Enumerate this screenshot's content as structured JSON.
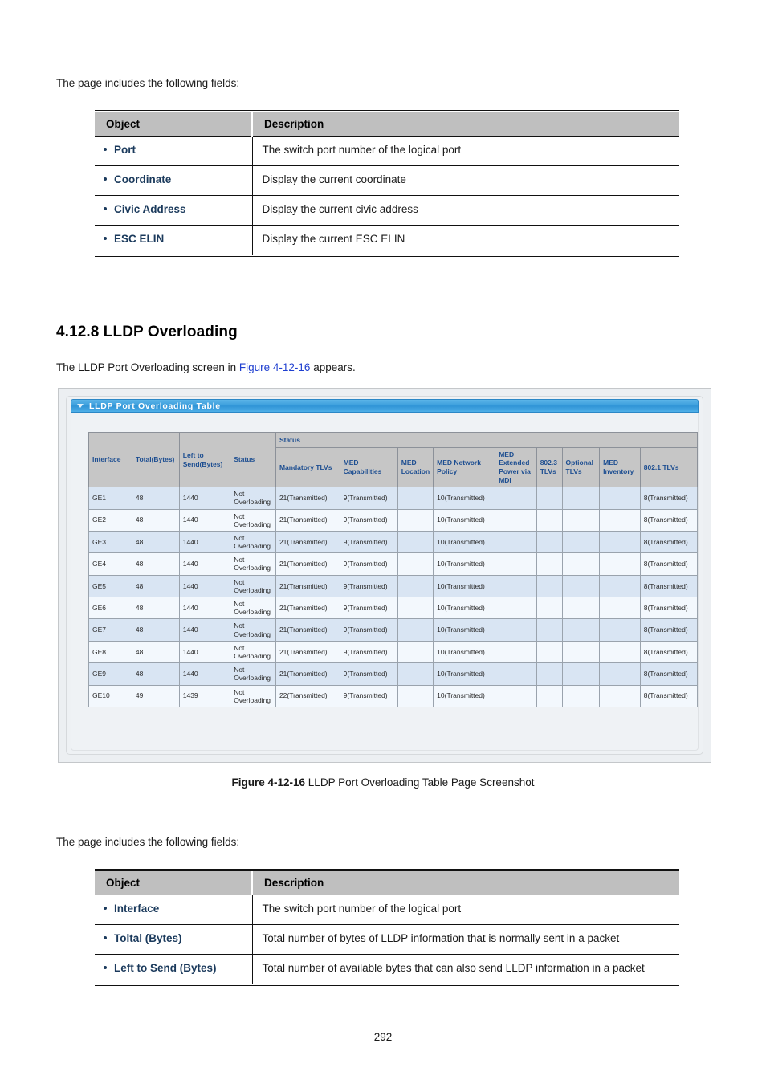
{
  "page": {
    "number": "292"
  },
  "intro_top": {
    "text": "The page includes the following fields:"
  },
  "fields_table_top": {
    "headers": [
      "Object",
      "Description"
    ],
    "rows": [
      {
        "object": "Port",
        "description": "The switch port number of the logical port"
      },
      {
        "object": "Coordinate",
        "description": "Display the current coordinate"
      },
      {
        "object": "Civic Address",
        "description": "Display the current civic address"
      },
      {
        "object": "ESC ELIN",
        "description": "Display the current ESC ELIN"
      }
    ]
  },
  "section": {
    "number": "4.12.8",
    "title": "LLDP Overloading",
    "heading": "4.12.8 LLDP Overloading",
    "intro_prefix": "The LLDP Port Overloading screen in ",
    "intro_link": "Figure 4-12-16",
    "intro_suffix": " appears."
  },
  "screenshot": {
    "panel_title": "LLDP Port Overloading Table",
    "collapse_icon": "triangle-down-icon",
    "group_header": "Status",
    "columns": [
      "Interface",
      "Total(Bytes)",
      "Left to Send(Bytes)",
      "Status",
      "Mandatory TLVs",
      "MED Capabilities",
      "MED Location",
      "MED Network Policy",
      "MED Extended Power via MDI",
      "802.3 TLVs",
      "Optional TLVs",
      "MED Inventory",
      "802.1 TLVs"
    ],
    "rows": [
      {
        "interface": "GE1",
        "total": "48",
        "left_to_send": "1440",
        "status": "Not Overloading",
        "mandatory_tlvs": "21(Transmitted)",
        "med_capabilities": "9(Transmitted)",
        "med_location": "",
        "med_network_policy": "10(Transmitted)",
        "med_ext_power": "",
        "tlvs_8023": "",
        "optional_tlvs": "",
        "med_inventory": "",
        "tlvs_8021": "8(Transmitted)"
      },
      {
        "interface": "GE2",
        "total": "48",
        "left_to_send": "1440",
        "status": "Not Overloading",
        "mandatory_tlvs": "21(Transmitted)",
        "med_capabilities": "9(Transmitted)",
        "med_location": "",
        "med_network_policy": "10(Transmitted)",
        "med_ext_power": "",
        "tlvs_8023": "",
        "optional_tlvs": "",
        "med_inventory": "",
        "tlvs_8021": "8(Transmitted)"
      },
      {
        "interface": "GE3",
        "total": "48",
        "left_to_send": "1440",
        "status": "Not Overloading",
        "mandatory_tlvs": "21(Transmitted)",
        "med_capabilities": "9(Transmitted)",
        "med_location": "",
        "med_network_policy": "10(Transmitted)",
        "med_ext_power": "",
        "tlvs_8023": "",
        "optional_tlvs": "",
        "med_inventory": "",
        "tlvs_8021": "8(Transmitted)"
      },
      {
        "interface": "GE4",
        "total": "48",
        "left_to_send": "1440",
        "status": "Not Overloading",
        "mandatory_tlvs": "21(Transmitted)",
        "med_capabilities": "9(Transmitted)",
        "med_location": "",
        "med_network_policy": "10(Transmitted)",
        "med_ext_power": "",
        "tlvs_8023": "",
        "optional_tlvs": "",
        "med_inventory": "",
        "tlvs_8021": "8(Transmitted)"
      },
      {
        "interface": "GE5",
        "total": "48",
        "left_to_send": "1440",
        "status": "Not Overloading",
        "mandatory_tlvs": "21(Transmitted)",
        "med_capabilities": "9(Transmitted)",
        "med_location": "",
        "med_network_policy": "10(Transmitted)",
        "med_ext_power": "",
        "tlvs_8023": "",
        "optional_tlvs": "",
        "med_inventory": "",
        "tlvs_8021": "8(Transmitted)"
      },
      {
        "interface": "GE6",
        "total": "48",
        "left_to_send": "1440",
        "status": "Not Overloading",
        "mandatory_tlvs": "21(Transmitted)",
        "med_capabilities": "9(Transmitted)",
        "med_location": "",
        "med_network_policy": "10(Transmitted)",
        "med_ext_power": "",
        "tlvs_8023": "",
        "optional_tlvs": "",
        "med_inventory": "",
        "tlvs_8021": "8(Transmitted)"
      },
      {
        "interface": "GE7",
        "total": "48",
        "left_to_send": "1440",
        "status": "Not Overloading",
        "mandatory_tlvs": "21(Transmitted)",
        "med_capabilities": "9(Transmitted)",
        "med_location": "",
        "med_network_policy": "10(Transmitted)",
        "med_ext_power": "",
        "tlvs_8023": "",
        "optional_tlvs": "",
        "med_inventory": "",
        "tlvs_8021": "8(Transmitted)"
      },
      {
        "interface": "GE8",
        "total": "48",
        "left_to_send": "1440",
        "status": "Not Overloading",
        "mandatory_tlvs": "21(Transmitted)",
        "med_capabilities": "9(Transmitted)",
        "med_location": "",
        "med_network_policy": "10(Transmitted)",
        "med_ext_power": "",
        "tlvs_8023": "",
        "optional_tlvs": "",
        "med_inventory": "",
        "tlvs_8021": "8(Transmitted)"
      },
      {
        "interface": "GE9",
        "total": "48",
        "left_to_send": "1440",
        "status": "Not Overloading",
        "mandatory_tlvs": "21(Transmitted)",
        "med_capabilities": "9(Transmitted)",
        "med_location": "",
        "med_network_policy": "10(Transmitted)",
        "med_ext_power": "",
        "tlvs_8023": "",
        "optional_tlvs": "",
        "med_inventory": "",
        "tlvs_8021": "8(Transmitted)"
      },
      {
        "interface": "GE10",
        "total": "49",
        "left_to_send": "1439",
        "status": "Not Overloading",
        "mandatory_tlvs": "22(Transmitted)",
        "med_capabilities": "9(Transmitted)",
        "med_location": "",
        "med_network_policy": "10(Transmitted)",
        "med_ext_power": "",
        "tlvs_8023": "",
        "optional_tlvs": "",
        "med_inventory": "",
        "tlvs_8021": "8(Transmitted)"
      }
    ]
  },
  "figure_caption": {
    "label": "Figure 4-12-16",
    "text": " LLDP Port Overloading Table Page Screenshot"
  },
  "intro_bottom": {
    "text": "The page includes the following fields:"
  },
  "fields_table_bottom": {
    "headers": [
      "Object",
      "Description"
    ],
    "rows": [
      {
        "object": "Interface",
        "description": "The switch port number of the logical port"
      },
      {
        "object": "Toltal (Bytes)",
        "description": "Total number of bytes of LLDP information that is normally sent in a packet"
      },
      {
        "object": "Left to Send (Bytes)",
        "description": "Total number of available bytes that can also send LLDP information in a packet"
      }
    ]
  },
  "colors": {
    "link": "#1f3fd0",
    "object_text": "#1b3a5c",
    "table_header_bg": "#bfbfbf",
    "grid_header_bg": "#c6c6c6",
    "grid_header_text": "#1d4e91",
    "row_odd": "#d9e5f3",
    "row_even": "#f3f8fd",
    "panel_bar": "#3d9fdd"
  }
}
